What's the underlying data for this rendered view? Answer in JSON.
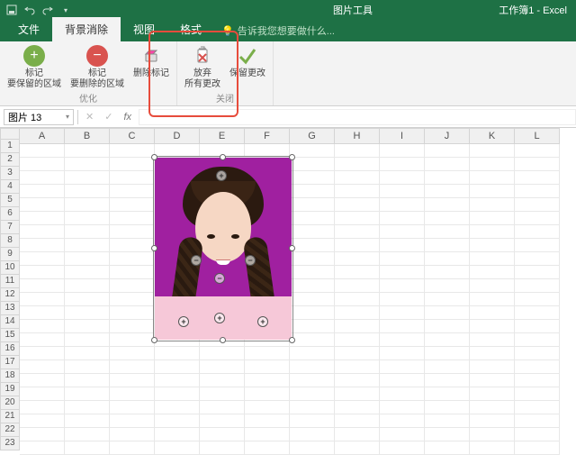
{
  "app_title": "工作簿1 - Excel",
  "context_tab": "图片工具",
  "tabs": {
    "file": "文件",
    "bg_remove": "背景消除",
    "view": "视图",
    "format": "格式"
  },
  "tell_me": "告诉我您想要做什么...",
  "ribbon": {
    "g1": {
      "keep_mark": "标记\n要保留的区域",
      "remove_mark": "标记\n要删除的区域",
      "delete_mark": "删除标记",
      "name": "优化"
    },
    "g2": {
      "discard": "放弃\n所有更改",
      "keep": "保留更改",
      "name": "关闭"
    }
  },
  "name_box": "图片 13",
  "fx_label": "fx",
  "columns": [
    "A",
    "B",
    "C",
    "D",
    "E",
    "F",
    "G",
    "H",
    "I",
    "J",
    "K",
    "L"
  ],
  "rows": [
    "1",
    "2",
    "3",
    "4",
    "5",
    "6",
    "7",
    "8",
    "9",
    "10",
    "11",
    "12",
    "13",
    "14",
    "15",
    "16",
    "17",
    "18",
    "19",
    "20",
    "21",
    "22",
    "23"
  ],
  "mark_plus": "+",
  "mark_minus": "−"
}
